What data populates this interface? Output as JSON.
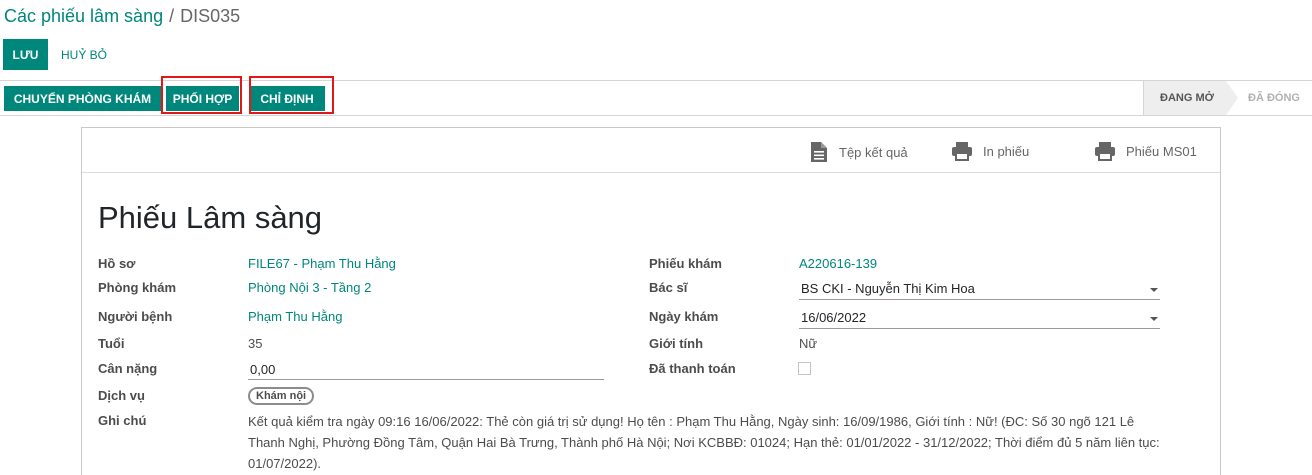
{
  "breadcrumb": {
    "parent": "Các phiếu lâm sàng",
    "separator": "/",
    "current": "DIS035"
  },
  "toolbar": {
    "save_label": "LƯU",
    "discard_label": "HUỶ BỎ"
  },
  "actions": {
    "transfer": "CHUYỂN PHÒNG KHÁM",
    "coordinate": "PHỐI HỢP",
    "assign": "CHỈ ĐỊNH"
  },
  "stages": {
    "open": "ĐANG MỞ",
    "closed": "ĐÃ ĐÓNG"
  },
  "sheet_buttons": {
    "result_file": "Tệp kết quả",
    "print": "In phiếu",
    "ms01": "Phiếu MS01"
  },
  "title": "Phiếu Lâm sàng",
  "left_fields": {
    "record_label": "Hồ sơ",
    "record_value": "FILE67 - Phạm Thu Hằng",
    "room_label": "Phòng khám",
    "room_value": "Phòng Nội 3 - Tầng 2",
    "patient_label": "Người bệnh",
    "patient_value": "Phạm Thu Hằng",
    "age_label": "Tuổi",
    "age_value": "35",
    "weight_label": "Cân nặng",
    "weight_value": "0,00",
    "service_label": "Dịch vụ",
    "service_tag": "Khám nội",
    "note_label": "Ghi chú",
    "note_value": "Kết quả kiểm tra ngày 09:16 16/06/2022: Thẻ còn giá trị sử dụng! Họ tên : Phạm Thu Hằng, Ngày sinh: 16/09/1986, Giới tính : Nữ! (ĐC: Số 30 ngõ 121 Lê Thanh Nghị, Phường Đồng Tâm, Quận Hai Bà Trưng, Thành phố Hà Nội; Nơi KCBBĐ: 01024; Hạn thẻ: 01/01/2022 - 31/12/2022; Thời điểm đủ 5 năm liên tục: 01/07/2022)."
  },
  "right_fields": {
    "exam_label": "Phiếu khám",
    "exam_value": "A220616-139",
    "doctor_label": "Bác sĩ",
    "doctor_value": "BS CKI - Nguyễn Thị Kim Hoa",
    "date_label": "Ngày khám",
    "date_value": "16/06/2022",
    "gender_label": "Giới tính",
    "gender_value": "Nữ",
    "paid_label": "Đã thanh toán",
    "paid_checked": false
  },
  "colors": {
    "primary": "#00877c",
    "highlight": "#e01818"
  }
}
